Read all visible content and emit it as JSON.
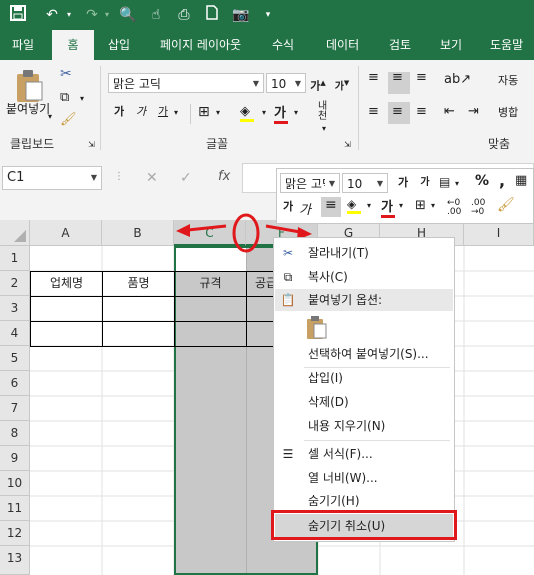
{
  "qat": {
    "icons": [
      "save-icon",
      "undo-icon",
      "redo-icon",
      "print-preview-icon",
      "touch-mode-icon",
      "new-document-icon",
      "camera-icon",
      "customize-qat-icon"
    ]
  },
  "tabs": [
    "파일",
    "홈",
    "삽입",
    "페이지 레이아웃",
    "수식",
    "데이터",
    "검토",
    "보기",
    "도움말"
  ],
  "ribbon": {
    "paste_label": "붙여넣기",
    "font_name": "맑은 고딕",
    "font_size": "10",
    "bold": "가",
    "italic": "가",
    "underline": "가",
    "grow_font": "가",
    "shrink_font": "가",
    "font_color_glyph": "가",
    "phonetic": "내천",
    "wrap_text": "자동",
    "merge": "병합",
    "groups": {
      "clipboard": "클립보드",
      "font": "글꼴",
      "alignment": "맞춤"
    }
  },
  "formula_bar": {
    "name_box": "C1",
    "fx": "fx"
  },
  "mini_toolbar": {
    "font_name": "맑은 고딕",
    "font_size": "10",
    "percent": "%",
    "comma": ",",
    "bold": "가",
    "grow": "가",
    "shrink": "가",
    "font_color": "가"
  },
  "grid": {
    "columns": [
      "A",
      "B",
      "C",
      "F",
      "G",
      "H",
      "I"
    ],
    "rows": [
      "1",
      "2",
      "3",
      "4",
      "5",
      "6",
      "7",
      "8",
      "9",
      "10",
      "11",
      "12",
      "13"
    ],
    "table_headers": [
      "업체명",
      "품명",
      "규격",
      "공급"
    ]
  },
  "context_menu": {
    "items": [
      "잘라내기(T)",
      "복사(C)",
      "붙여넣기 옵션:",
      "선택하여 붙여넣기(S)...",
      "삽입(I)",
      "삭제(D)",
      "내용 지우기(N)",
      "셀 서식(F)...",
      "열 너비(W)...",
      "숨기기(H)",
      "숨기기 취소(U)"
    ]
  },
  "colors": {
    "excel_green": "#217346",
    "highlight_red": "#e0181b",
    "selection_grey": "#c8c8c8"
  }
}
